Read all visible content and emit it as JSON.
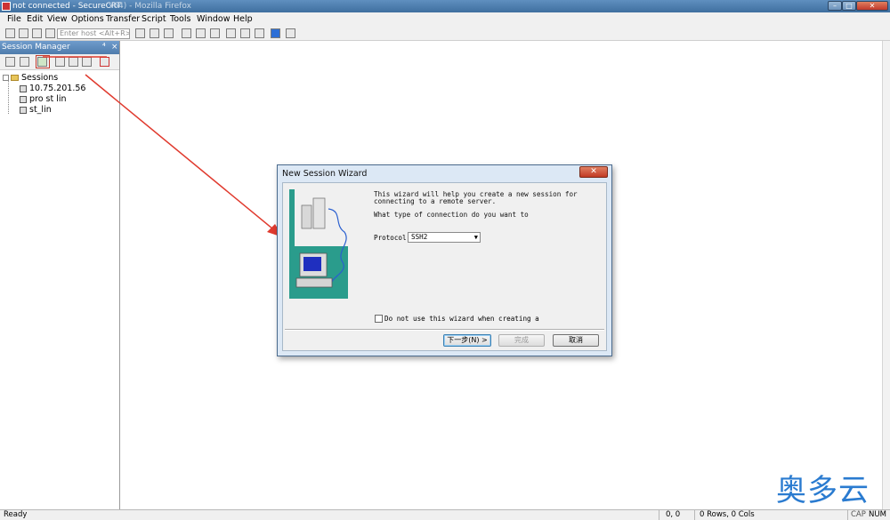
{
  "window": {
    "title": "not connected - SecureCRT",
    "title_faded": "x64) - Mozilla Firefox",
    "controls": {
      "minimize": "–",
      "maximize": "□",
      "close": "✕"
    }
  },
  "menu": {
    "items": [
      "File",
      "Edit",
      "View",
      "Options",
      "Transfer",
      "Script",
      "Tools",
      "Window",
      "Help"
    ]
  },
  "toolbar": {
    "host_placeholder": "Enter host <Alt+R>"
  },
  "session_manager": {
    "title": "Session Manager",
    "pin_glyph": "⁴",
    "close_glyph": "×",
    "tree": {
      "root": "Sessions",
      "items": [
        "10.75.201.56",
        "pro st lin",
        "st_lin"
      ]
    }
  },
  "dialog": {
    "title": "New Session Wizard",
    "close_glyph": "✕",
    "intro_line1": "This wizard will help you create a new session for",
    "intro_line2": "connecting to a remote server.",
    "question": "What type of connection do you want to",
    "protocol_label": "Protocol",
    "protocol_value": "SSH2",
    "checkbox_label": "Do not use this wizard when creating a",
    "buttons": {
      "next": "下一步(N) >",
      "finish": "完成",
      "cancel": "取消"
    }
  },
  "statusbar": {
    "status": "Ready",
    "position": "0, 0",
    "size": "0 Rows, 0 Cols",
    "caps": "CAP",
    "num": "NUM"
  },
  "watermark": "奥多云",
  "colors": {
    "annotation": "#e03a2e",
    "wizard_bg": "#2a9c8c",
    "watermark": "#2a7bd0"
  }
}
